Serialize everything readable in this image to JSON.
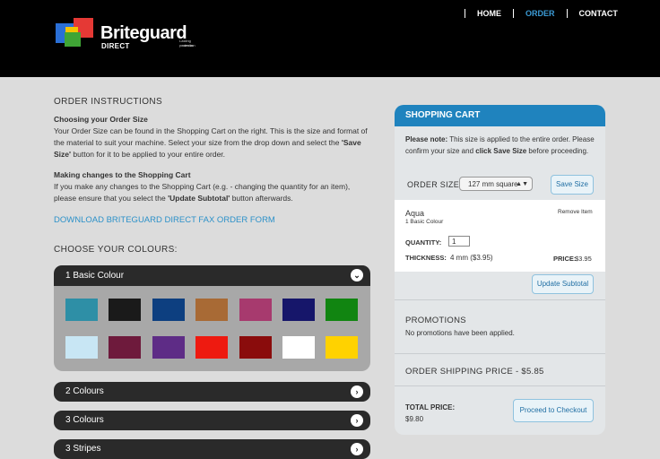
{
  "header": {
    "brand": "Briteguard",
    "brand_sub": "DIRECT",
    "domain_suffix": ".com.au",
    "tagline": "Lasting protection",
    "nav": [
      "HOME",
      "ORDER",
      "CONTACT"
    ],
    "active_nav": "ORDER",
    "logo_colors": [
      "#2a6fd6",
      "#e53935",
      "#f5c400",
      "#3fa535"
    ]
  },
  "instructions": {
    "heading": "ORDER INSTRUCTIONS",
    "choosing_title": "Choosing your Order Size",
    "choosing_text_1": "Your Order Size can be found in the Shopping Cart on the right. This is the size and format of the material to suit your machine. Select your size from the drop down and select the ",
    "choosing_bold": "'Save Size'",
    "choosing_text_2": " button for it to be applied to your entire order.",
    "changes_title": "Making changes to the Shopping Cart",
    "changes_text_1": "If you make any changes to the Shopping Cart (e.g. - changing the quantity for an item), please ensure that you select the ",
    "changes_bold": "'Update Subtotal'",
    "changes_text_2": " button afterwards.",
    "download_link": "DOWNLOAD BRITEGUARD DIRECT FAX ORDER FORM"
  },
  "colours": {
    "heading": "CHOOSE YOUR COLOURS:",
    "sections": [
      "1 Basic Colour",
      "2 Colours",
      "3 Colours",
      "3 Stripes"
    ],
    "row1": [
      "#2e8fa6",
      "#1a1a1a",
      "#0d3f80",
      "#a86a35",
      "#a73a6e",
      "#16166a",
      "#118511"
    ],
    "row2": [
      "#c8e6f4",
      "#6e1a3c",
      "#5e2c86",
      "#ee1a10",
      "#8a0c0c",
      "#ffffff",
      "#ffd200"
    ]
  },
  "cart": {
    "title": "SHOPPING CART",
    "note_bold": "Please note:",
    "note_text_1": " This size is applied to the entire order. Please confirm your size and ",
    "note_bold2": "click Save Size",
    "note_text_2": " before proceeding.",
    "order_size_label": "ORDER SIZE:",
    "order_size_value": "127 mm square",
    "save_size": "Save Size",
    "item_name": "Aqua",
    "item_sub": "1 Basic Colour",
    "remove": "Remove Item",
    "quantity_label": "QUANTITY:",
    "quantity_value": "1",
    "thickness_label": "THICKNESS:",
    "thickness_value": "4 mm ($3.95)",
    "price_label": "PRICE:",
    "price_value": "$3.95",
    "update_subtotal": "Update Subtotal",
    "promotions_title": "PROMOTIONS",
    "promotions_text": "No promotions have been applied.",
    "shipping": "ORDER SHIPPING PRICE - $5.85",
    "total_label": "TOTAL PRICE:",
    "total_value": "$9.80",
    "checkout": "Proceed to Checkout"
  }
}
